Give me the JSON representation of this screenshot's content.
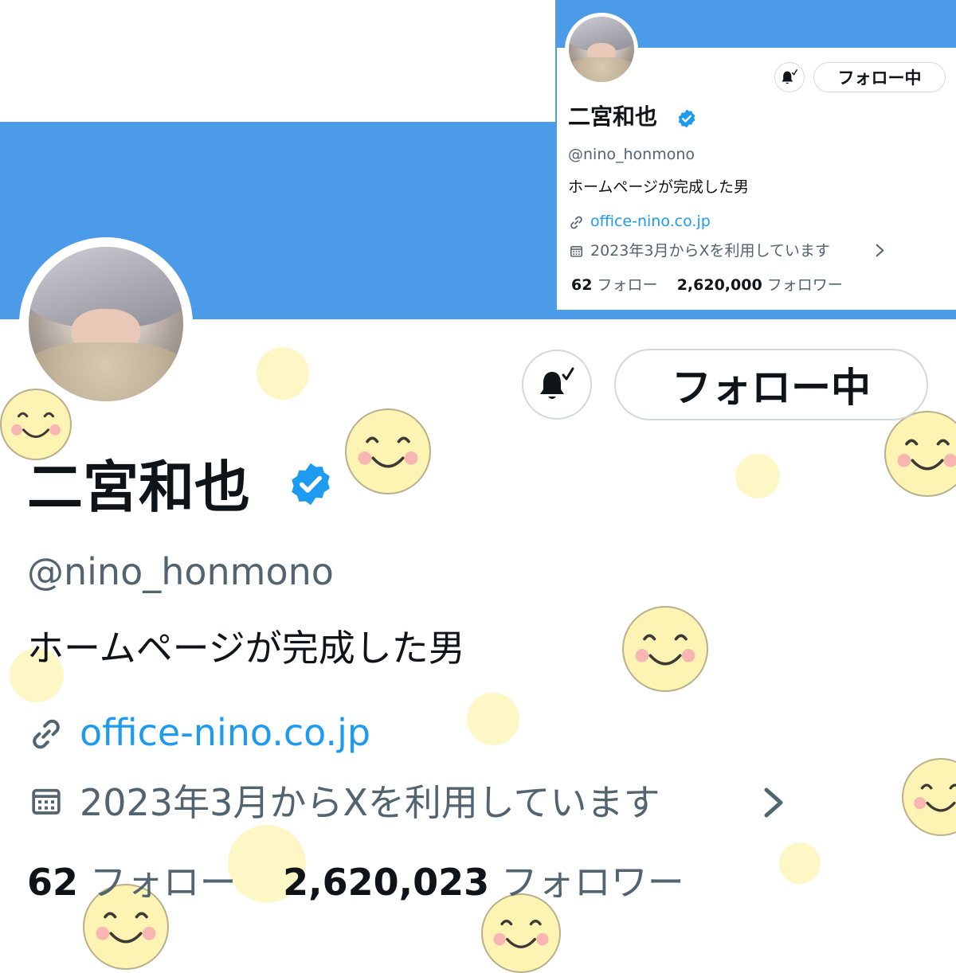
{
  "colors": {
    "banner": "#4c9be8",
    "text_primary": "#0f1419",
    "text_secondary": "#536471",
    "link": "#1d9bf0",
    "verified": "#1d9bf0",
    "border": "#cfd9de",
    "sticker_yellow": "#fdf3b3"
  },
  "profile": {
    "display_name": "二宮和也",
    "handle": "@nino_honmono",
    "bio": "ホームページが完成した男",
    "website": "office-nino.co.jp",
    "joined": "2023年3月からXを利用しています",
    "follow_button_label": "フォロー中",
    "following_count": "62",
    "following_label": "フォロー",
    "followers_count": "2,620,023",
    "followers_label": "フォロワー",
    "icons": [
      "bell-check-icon",
      "verified-badge-icon",
      "link-icon",
      "calendar-icon",
      "chevron-right-icon"
    ]
  },
  "inset_profile": {
    "display_name": "二宮和也",
    "handle": "@nino_honmono",
    "bio": "ホームページが完成した男",
    "website": "office-nino.co.jp",
    "joined": "2023年3月からXを利用しています",
    "follow_button_label": "フォロー中",
    "following_count": "62",
    "following_label": "フォロー",
    "followers_count": "2,620,000",
    "followers_label": "フォロワー"
  }
}
